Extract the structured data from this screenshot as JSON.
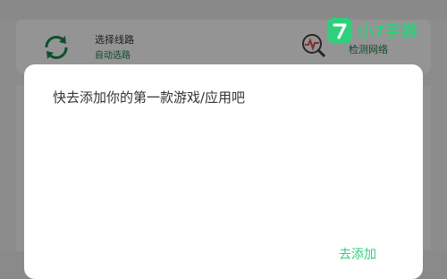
{
  "background": {
    "left_item": {
      "title": "选择线路",
      "subtitle": "自动选路",
      "icon": "refresh-cycle-icon"
    },
    "right_item": {
      "label": "检测网络",
      "icon": "network-diagnose-icon"
    }
  },
  "dialog": {
    "message": "快去添加你的第一款游戏/应用吧",
    "action_label": "去添加"
  },
  "watermark": {
    "text": "小7手游",
    "icon": "seven-logo-icon"
  },
  "colors": {
    "accent": "#2fd07c",
    "background_green_text": "#1e7d4a",
    "refresh_icon_green": "#1a8a4a",
    "diagnose_icon_red": "#d9534f",
    "dialog_text": "#333333"
  }
}
